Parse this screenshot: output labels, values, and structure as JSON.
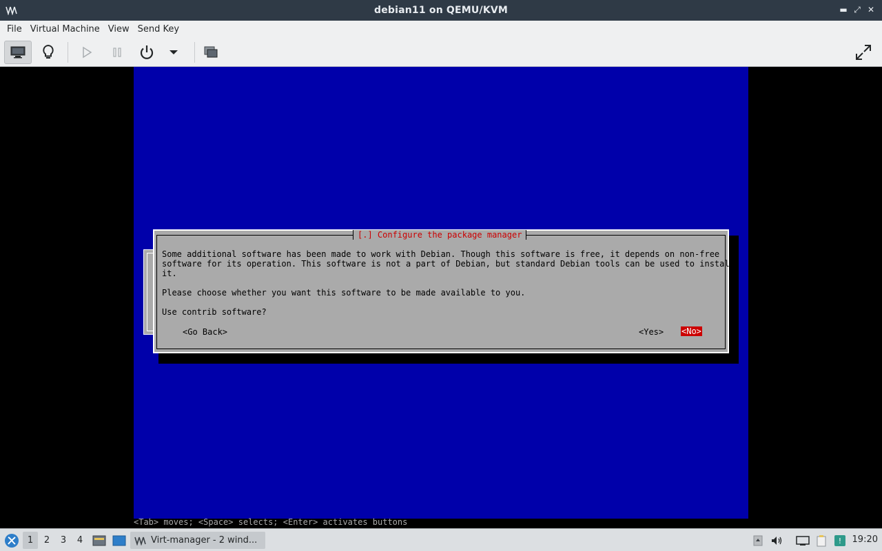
{
  "window": {
    "title": "debian11 on QEMU/KVM",
    "controls": [
      "minimize-icon",
      "restore-icon",
      "close-icon"
    ]
  },
  "menubar": {
    "items": [
      "File",
      "Virtual Machine",
      "View",
      "Send Key"
    ]
  },
  "toolbar": {
    "buttons": [
      "console-icon",
      "lightbulb-icon",
      "play-icon",
      "pause-icon",
      "power-icon",
      "dropdown-arrow-icon",
      "snapshot-icon",
      "fullscreen-icon"
    ]
  },
  "installer": {
    "dialog_title": "[.] Configure the package manager",
    "lines": [
      "Some additional software has been made to work with Debian. Though this software is free, it depends on non-free",
      "software for its operation. This software is not a part of Debian, but standard Debian tools can be used to install",
      "it.",
      "Please choose whether you want this software to be made available to you.",
      "Use contrib software?"
    ],
    "go_back": "<Go Back>",
    "yes": "<Yes>",
    "no": "<No>",
    "help": "<Tab> moves; <Space> selects; <Enter> activates buttons"
  },
  "taskbar": {
    "desktops": [
      "1",
      "2",
      "3",
      "4"
    ],
    "task_label": "Virt-manager - 2 wind...",
    "clock": "19:20"
  },
  "colors": {
    "console_bg": "#0000aa",
    "dialog_bg": "#aaaaaa",
    "accent_red": "#cc0000"
  }
}
